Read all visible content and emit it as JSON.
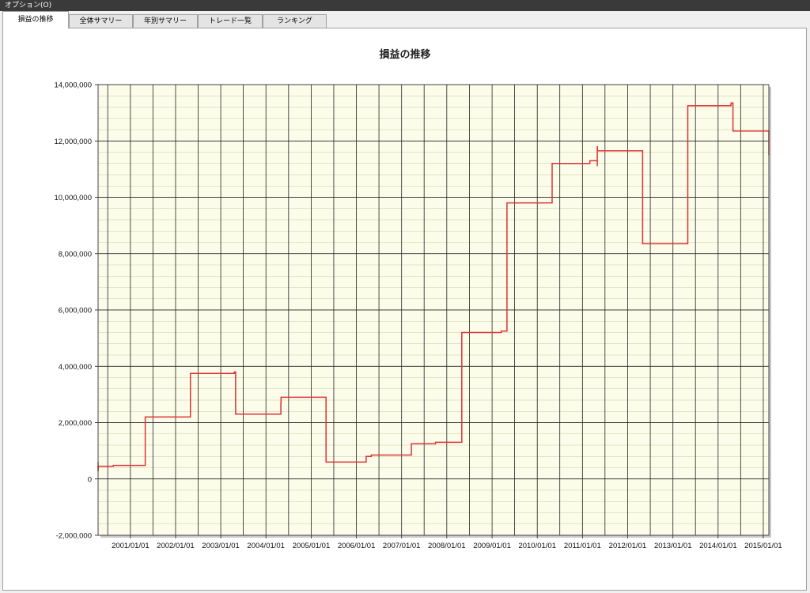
{
  "menubar": {
    "options_label": "オプション(O)"
  },
  "tabs": [
    {
      "label": "損益の推移",
      "active": true
    },
    {
      "label": "全体サマリー",
      "active": false
    },
    {
      "label": "年別サマリー",
      "active": false
    },
    {
      "label": "トレード一覧",
      "active": false
    },
    {
      "label": "ランキング",
      "active": false
    }
  ],
  "colors": {
    "plot_bg": "#fcfceb",
    "line": "#dd3333",
    "major_grid": "#000000",
    "minor_grid": "#cccc99"
  },
  "chart_data": {
    "type": "line",
    "title": "損益の推移",
    "xlabel": "",
    "ylabel": "",
    "step": true,
    "ylim": [
      -2000000,
      14000000
    ],
    "xlim": [
      "2000-04-15",
      "2015-02-15"
    ],
    "yticks": [
      -2000000,
      0,
      2000000,
      4000000,
      6000000,
      8000000,
      10000000,
      12000000,
      14000000
    ],
    "ytick_labels": [
      "-2,000,000",
      "0",
      "2,000,000",
      "4,000,000",
      "6,000,000",
      "8,000,000",
      "10,000,000",
      "12,000,000",
      "14,000,000"
    ],
    "xticks": [
      "2001-01-01",
      "2002-01-01",
      "2003-01-01",
      "2004-01-01",
      "2005-01-01",
      "2006-01-01",
      "2007-01-01",
      "2008-01-01",
      "2009-01-01",
      "2010-01-01",
      "2011-01-01",
      "2012-01-01",
      "2013-01-01",
      "2014-01-01",
      "2015-01-01"
    ],
    "xtick_labels": [
      "2001/01/01",
      "2002/01/01",
      "2003/01/01",
      "2004/01/01",
      "2005/01/01",
      "2006/01/01",
      "2007/01/01",
      "2008/01/01",
      "2009/01/01",
      "2010/01/01",
      "2011/01/01",
      "2012/01/01",
      "2013/01/01",
      "2014/01/01",
      "2015/01/01"
    ],
    "grid": true,
    "legend": "none",
    "series": [
      {
        "x": [
          "2000-04-15",
          "2000-04-15",
          "2000-04-16",
          "2000-08-15",
          "2000-08-16",
          "2001-05-01",
          "2002-05-01",
          "2003-04-20",
          "2003-04-21",
          "2003-05-01",
          "2004-05-01",
          "2004-05-01",
          "2004-05-02",
          "2005-05-01",
          "2006-03-20",
          "2006-03-21",
          "2006-05-01",
          "2007-03-20",
          "2007-03-21",
          "2007-04-01",
          "2007-10-01",
          "2007-10-02",
          "2008-05-01",
          "2009-03-15",
          "2009-03-16",
          "2009-05-01",
          "2010-05-01",
          "2011-03-01",
          "2011-03-02",
          "2011-05-01",
          "2011-05-01",
          "2011-05-02",
          "2012-05-01",
          "2013-05-01",
          "2014-04-15",
          "2014-04-16",
          "2014-05-01",
          "2015-02-15"
        ],
        "y": [
          600000,
          300000,
          450000,
          450000,
          480000,
          2200000,
          3750000,
          3750000,
          3800000,
          2300000,
          2300000,
          2700000,
          2900000,
          600000,
          600000,
          800000,
          850000,
          850000,
          1250000,
          1250000,
          1250000,
          1300000,
          5200000,
          5200000,
          5250000,
          9800000,
          11200000,
          11200000,
          11300000,
          11100000,
          11800000,
          11650000,
          8350000,
          13250000,
          13300000,
          13350000,
          12350000,
          11500000
        ]
      }
    ]
  }
}
